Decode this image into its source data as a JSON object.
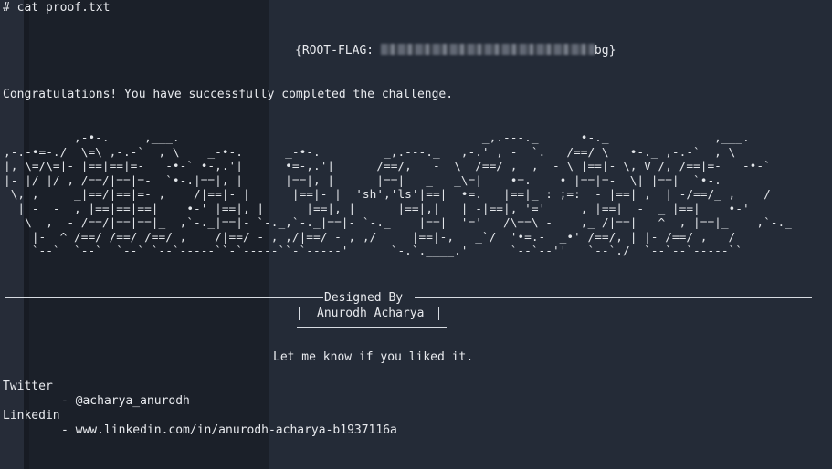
{
  "terminal": {
    "command": "# cat proof.txt",
    "flag_prefix": "{ROOT-FLAG: ",
    "flag_suffix": "bg}",
    "congrats": "Congratulations! You have successfully completed the challenge.",
    "ascii_art": "          ,-•-.     ,___.                                           _,.---._      •-._               ,___.\n,-.-•=-./  \\=\\ ,-.-`  , \\    _-•-.      _-•-.         _,.---._   ,-.' , -  `.   /==/ \\   •-._ ,-.-`  , \\\n|, \\=/\\=|- |==|==|=-  _-•-` •-,.'|      •=-,.'|      /==/,   -  \\  /==/_,  ,  - \\ |==|- \\, V /, /==|=-  _-•-`\n|- |/ |/ , /==/|==|=-  `•-.|==|, |      |==|, |      |==|   _   _\\=|    •=.    • |==|=-  \\| |==|  `•-.\n \\, ,     _|==/|==|=- ,    /|==|- |      |==|- |  'sh','ls'|==|  •=.   |==|_ : ;=:  - |==| ,  | -/==/_ ,    /\n  | -  -  , |==|==|==|    •-' |==|, |      |==|, |      |==|,|   | -|==|, '='     , |==|  -  _ |==|    •-'\n   \\  ,  - /==/|==|==|_  ,`-._|==|- `-._,`-._|==|- `-._    |==|  '='   /\\==\\ -    ,_ /|==|   ^  , |==|_    ,`-._\n    |-  ^ /==/ /==/ /==/ ,    /|==/ - , ,/|==/ - , ,/     |==|-,   _`/  '•=.-  _•' /==/, | |- /==/ ,   /\n    `--`  `--`  `--` `--`-----``-`-----``-`-----'      `-.`.____.'      `--`--''   `--`./  `--`--`-----``",
    "designed_by": "Designed By",
    "author": "Anurodh Acharya",
    "like": "Let me know if you liked it.",
    "twitter_label": "Twitter",
    "twitter_handle": "- @acharya_anurodh",
    "linkedin_label": "Linkedin",
    "linkedin_url": "- www.linkedin.com/in/anurodh-acharya-b1937116a"
  }
}
